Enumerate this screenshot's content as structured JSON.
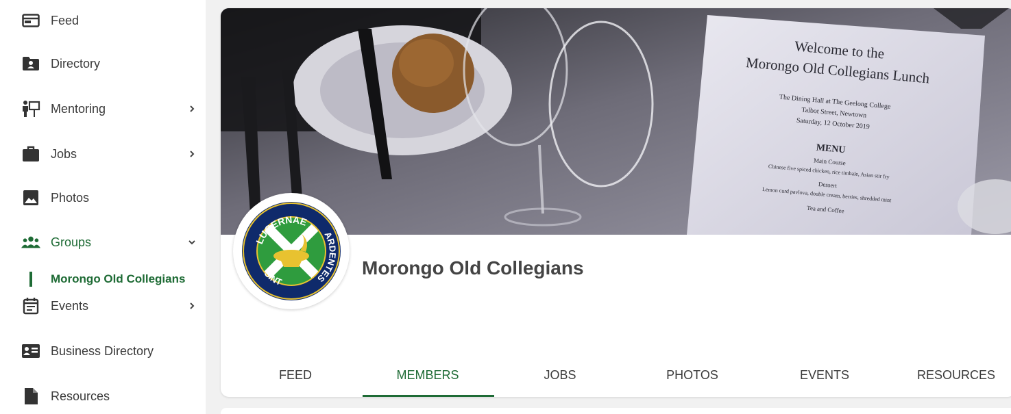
{
  "sidebar": {
    "items": [
      {
        "label": "Feed",
        "icon": "feed-icon"
      },
      {
        "label": "Directory",
        "icon": "directory-icon"
      },
      {
        "label": "Mentoring",
        "icon": "mentoring-icon"
      },
      {
        "label": "Jobs",
        "icon": "briefcase-icon"
      },
      {
        "label": "Photos",
        "icon": "photo-icon"
      },
      {
        "label": "Groups",
        "icon": "groups-icon"
      },
      {
        "label": "Events",
        "icon": "calendar-icon"
      },
      {
        "label": "Business Directory",
        "icon": "business-card-icon"
      },
      {
        "label": "Resources",
        "icon": "document-icon"
      }
    ],
    "active_sub_item": "Morongo Old Collegians"
  },
  "group": {
    "name": "Morongo Old Collegians",
    "logo_text": {
      "top": "LUCERNAE",
      "right": "ARDENTES",
      "left": "SINT"
    }
  },
  "banner": {
    "menu_title_1": "Welcome to the",
    "menu_title_2": "Morongo Old Collegians Lunch",
    "menu_line_1": "The Dining Hall at The Geelong College",
    "menu_line_2": "Talbot Street, Newtown",
    "menu_line_3": "Saturday, 12 October 2019",
    "menu_heading": "MENU",
    "menu_main": "Main Course",
    "menu_main_desc": "Chinese five spiced chicken, rice timbale, Asian stir fry",
    "menu_dessert": "Dessert",
    "menu_dessert_desc": "Lemon curd pavlova, double cream, berries, shredded mint",
    "menu_tea": "Tea and Coffee"
  },
  "tabs": [
    "FEED",
    "MEMBERS",
    "JOBS",
    "PHOTOS",
    "EVENTS",
    "RESOURCES"
  ],
  "active_tab": "MEMBERS",
  "colors": {
    "accent": "#1e6b35",
    "text": "#3a3a3a",
    "logo_navy": "#0f2a6b",
    "logo_green": "#2f9c3e",
    "logo_gold": "#e8c230"
  }
}
